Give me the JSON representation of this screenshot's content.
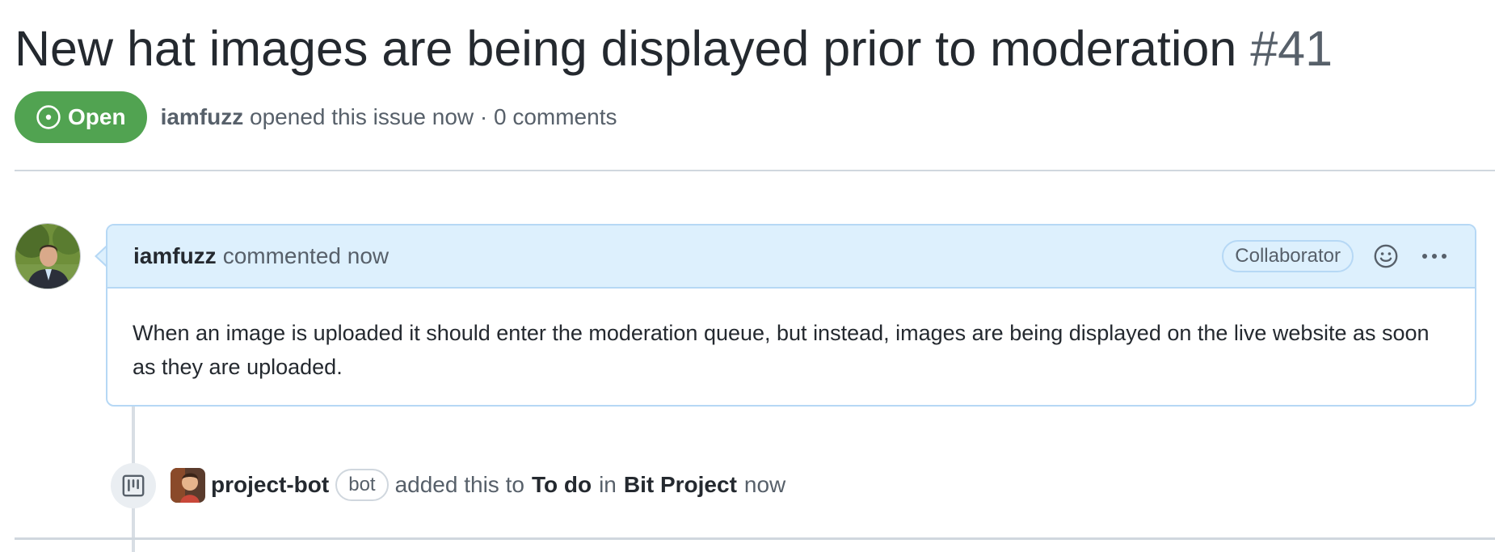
{
  "issue": {
    "title": "New hat images are being displayed prior to moderation",
    "number": "#41",
    "state": "Open",
    "author": "iamfuzz",
    "opened_text": "opened this issue now · 0 comments"
  },
  "comment": {
    "author": "iamfuzz",
    "action": "commented now",
    "role_badge": "Collaborator",
    "body": "When an image is uploaded it should enter the moderation queue, but instead, images are being displayed on the live website as soon as they are uploaded."
  },
  "event": {
    "actor": "project-bot",
    "actor_badge": "bot",
    "text_added": "added this to",
    "column": "To do",
    "text_in": "in",
    "project": "Bit Project",
    "time": "now"
  },
  "icons": {
    "state": "issue-opened-icon",
    "reaction": "smiley-icon",
    "menu": "kebab-horizontal-icon",
    "event": "project-icon"
  },
  "colors": {
    "open_green": "#51a351",
    "comment_header_bg": "#ddf0fd",
    "comment_border": "#b6d8f5",
    "muted_text": "#57606a"
  }
}
